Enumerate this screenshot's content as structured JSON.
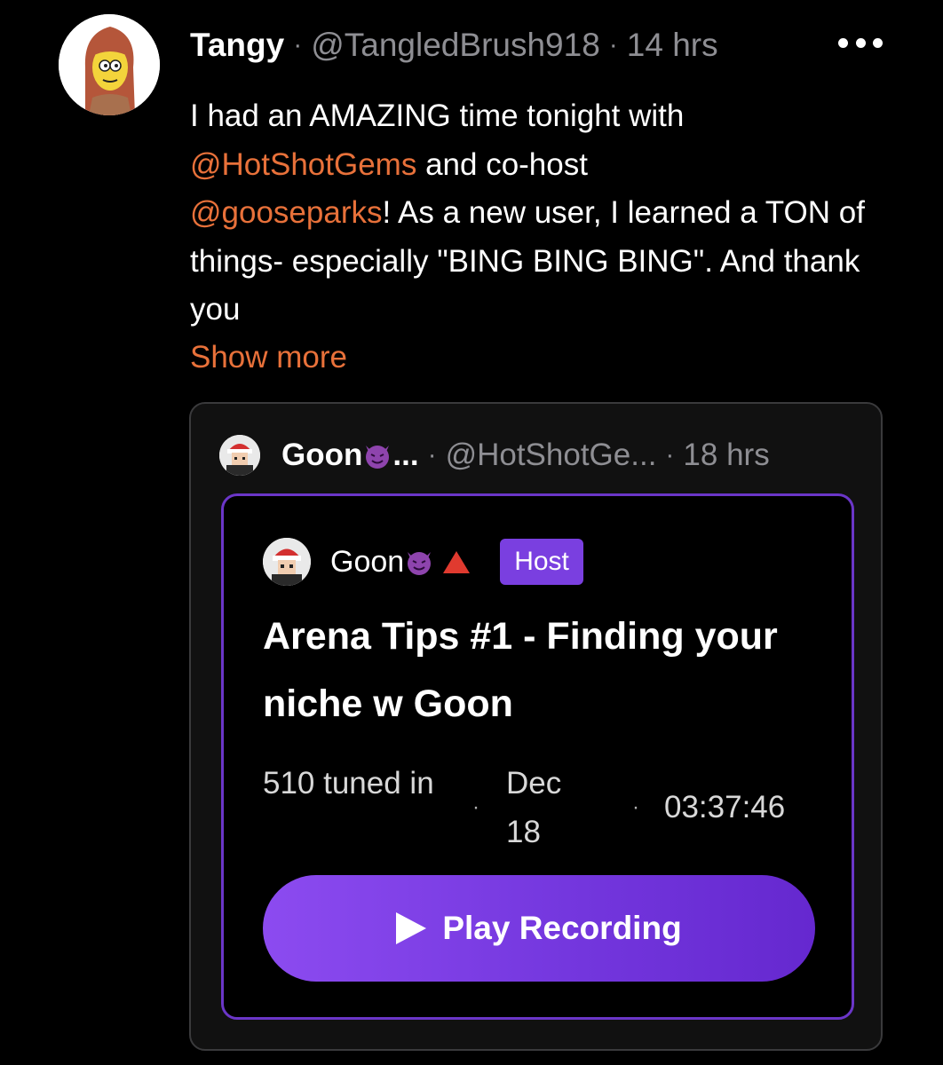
{
  "post": {
    "display_name": "Tangy",
    "handle": "@TangledBrush918",
    "time": "14 hrs",
    "separator": "·",
    "more_icon": "ellipsis-icon",
    "text_parts": {
      "intro": "I had an AMAZING time tonight with ",
      "mention1": "@HotShotGems",
      "mid": " and co-host ",
      "mention2": "@gooseparks",
      "rest": "! As a new user, I learned a TON of things- especially \"BING BING BING\". And thank you"
    },
    "show_more": "Show more"
  },
  "quote": {
    "display_name": "Goon",
    "name_emoji": "smiling-imp-emoji",
    "ellipsis": "...",
    "handle": "@HotShotGe...",
    "time": "18 hrs",
    "space": {
      "host_name": "Goon",
      "host_badge": "Host",
      "title": "Arena Tips #1 - Finding your niche w Goon",
      "listeners": "510 tuned in",
      "date": "Dec 18",
      "duration": "03:37:46",
      "dot": "·",
      "play_label": "Play Recording"
    }
  },
  "colors": {
    "accent_orange": "#e8713a",
    "purple": "#7a3fe0",
    "muted": "#8e8e93"
  }
}
